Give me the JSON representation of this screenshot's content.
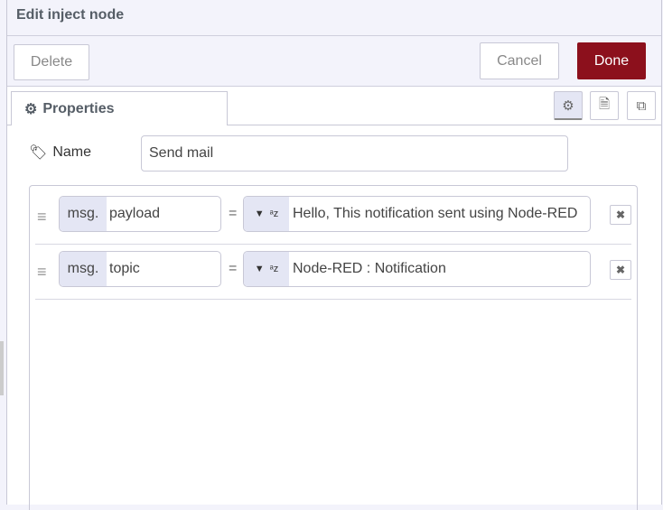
{
  "dialog": {
    "title": "Edit inject node"
  },
  "toolbar": {
    "delete_label": "Delete",
    "cancel_label": "Cancel",
    "done_label": "Done"
  },
  "tabs": {
    "properties_label": "Properties",
    "icons": [
      "gear-icon",
      "description-icon",
      "appearance-icon"
    ]
  },
  "form": {
    "name_label": "Name",
    "name_value": "Send mail"
  },
  "props": [
    {
      "prefix": "msg.",
      "property": "payload",
      "type": "string",
      "value": "Hello, This notification sent using Node-RED"
    },
    {
      "prefix": "msg.",
      "property": "topic",
      "type": "string",
      "value": "Node-RED : Notification"
    }
  ],
  "colors": {
    "done": "#8c101c"
  }
}
